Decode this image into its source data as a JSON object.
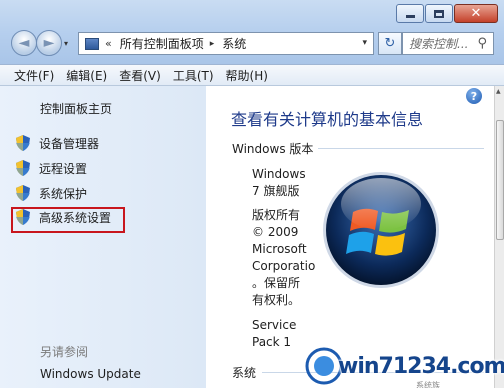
{
  "window": {
    "min_label": "",
    "max_label": "",
    "close_label": "✕"
  },
  "nav": {
    "back_glyph": "◄",
    "forward_glyph": "►",
    "dropdown_glyph": "▾"
  },
  "address": {
    "overflow": "«",
    "crumbs": [
      "所有控制面板项",
      "系统"
    ],
    "crumb_separator": "▸",
    "dropdown_glyph": "▾",
    "refresh_glyph": "↻"
  },
  "search": {
    "placeholder": "搜索控制...",
    "icon": "search-icon"
  },
  "menu": [
    "文件(F)",
    "编辑(E)",
    "查看(V)",
    "工具(T)",
    "帮助(H)"
  ],
  "sidebar": {
    "home": "控制面板主页",
    "links": [
      "设备管理器",
      "远程设置",
      "系统保护",
      "高级系统设置"
    ],
    "highlighted": "高级系统设置",
    "see_also": "另请参阅",
    "windows_update": "Windows Update"
  },
  "content": {
    "help_glyph": "?",
    "title": "查看有关计算机的基本信息",
    "edition_section": "Windows 版本",
    "edition_lines": [
      "Windows",
      "7 旗舰版"
    ],
    "copyright_lines": [
      "版权所有",
      "© 2009",
      "Microsoft",
      "Corporatio",
      "。保留所",
      "有权利。"
    ],
    "sp_lines": [
      "Service",
      "Pack 1"
    ],
    "system_section": "系统"
  },
  "watermark": {
    "text": "win71234.com",
    "sub": "系统族"
  },
  "colors": {
    "heading": "#1e3a8a",
    "highlight_border": "#c8161d",
    "content_bg": "#ffffff",
    "sidebar_bg": "#e3edf8"
  }
}
